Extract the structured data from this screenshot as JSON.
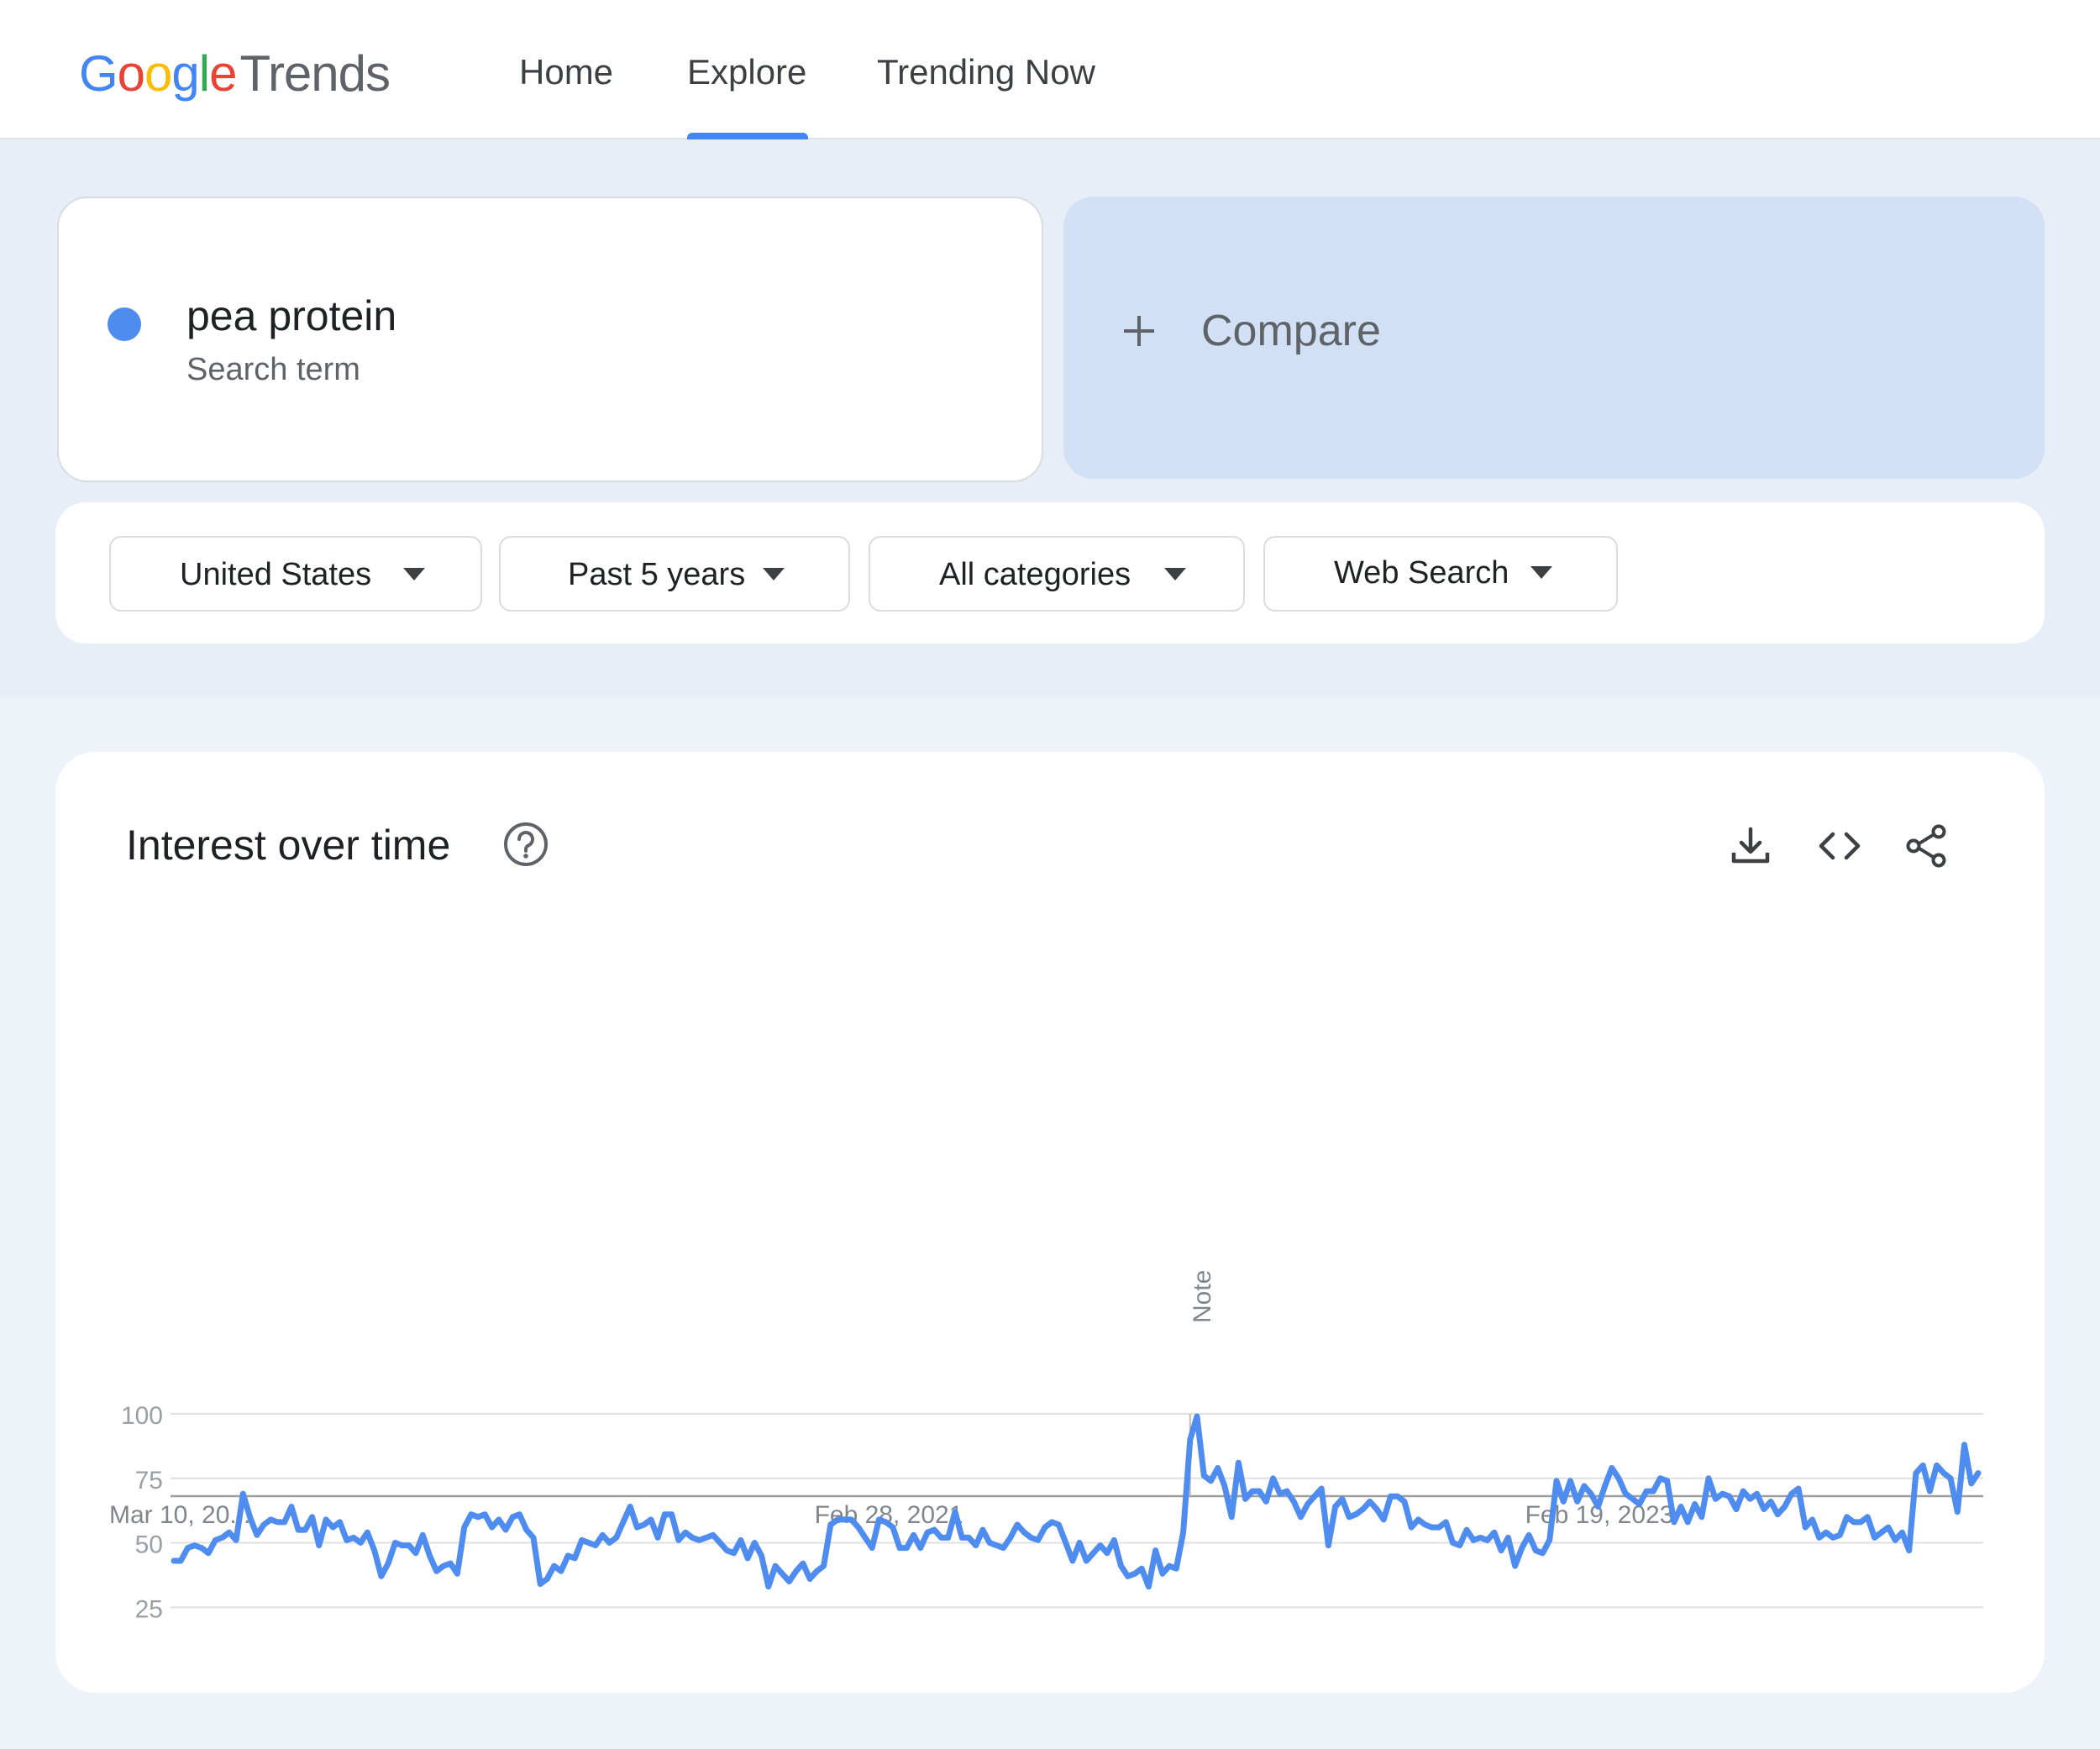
{
  "header": {
    "logo": {
      "brand_letters": [
        {
          "char": "G",
          "color": "#4285F4"
        },
        {
          "char": "o",
          "color": "#EA4335"
        },
        {
          "char": "o",
          "color": "#FBBC05"
        },
        {
          "char": "g",
          "color": "#4285F4"
        },
        {
          "char": "l",
          "color": "#34A853"
        },
        {
          "char": "e",
          "color": "#EA4335"
        }
      ],
      "product": "Trends"
    },
    "tabs": [
      {
        "label": "Home",
        "active": false
      },
      {
        "label": "Explore",
        "active": true
      },
      {
        "label": "Trending Now",
        "active": false
      }
    ],
    "active_color": "#4285f4"
  },
  "search": {
    "term": "pea protein",
    "term_type": "Search term",
    "term_color": "#4e8cf0",
    "compare_icon": "plus-icon",
    "compare_label": "Compare"
  },
  "filters": [
    {
      "label": "United States",
      "icon": "caret-down-icon"
    },
    {
      "label": "Past 5 years",
      "icon": "caret-down-icon"
    },
    {
      "label": "All categories",
      "icon": "caret-down-icon"
    },
    {
      "label": "Web Search",
      "icon": "caret-down-icon"
    }
  ],
  "panel": {
    "title": "Interest over time",
    "help_icon": "help-circle-icon",
    "tools": [
      "download-icon",
      "embed-code-icon",
      "share-icon"
    ]
  },
  "chart_data": {
    "type": "line",
    "title": "",
    "xlabel": "",
    "ylabel": "",
    "ylim": [
      0,
      100
    ],
    "yticks": [
      25,
      50,
      75,
      100
    ],
    "gridlines": true,
    "x_tick_labels": [
      "Mar 10, 20...",
      "Feb 28, 2021",
      "Feb 19, 2023"
    ],
    "annotation": {
      "label": "Note",
      "at_week_index": 147
    },
    "series_color": "#4e8cf0",
    "series": [
      {
        "values": [
          43,
          43,
          48,
          49,
          48,
          46,
          51,
          52,
          54,
          51,
          69,
          60,
          53,
          57,
          59,
          58,
          58,
          64,
          55,
          55,
          60,
          49,
          59,
          56,
          58,
          51,
          52,
          50,
          54,
          47,
          37,
          42,
          50,
          49,
          49,
          46,
          53,
          45,
          39,
          41,
          42,
          38,
          56,
          61,
          60,
          61,
          56,
          59,
          55,
          60,
          61,
          55,
          52,
          34,
          36,
          41,
          39,
          45,
          44,
          51,
          50,
          49,
          53,
          50,
          52,
          58,
          64,
          56,
          57,
          59,
          52,
          61,
          61,
          51,
          54,
          52,
          51,
          52,
          53,
          50,
          47,
          46,
          51,
          44,
          50,
          45,
          33,
          41,
          38,
          35,
          39,
          42,
          36,
          39,
          41,
          57,
          59,
          59,
          59,
          56,
          52,
          48,
          59,
          58,
          56,
          48,
          48,
          53,
          48,
          54,
          55,
          52,
          52,
          62,
          52,
          52,
          49,
          55,
          50,
          49,
          48,
          52,
          57,
          54,
          52,
          51,
          56,
          58,
          57,
          50,
          43,
          50,
          43,
          46,
          49,
          46,
          51,
          41,
          37,
          38,
          40,
          33,
          47,
          38,
          41,
          40,
          54,
          90,
          99,
          76,
          74,
          79,
          72,
          60,
          81,
          67,
          70,
          70,
          66,
          75,
          69,
          70,
          66,
          60,
          65,
          68,
          71,
          49,
          64,
          67,
          60,
          61,
          63,
          66,
          63,
          59,
          68,
          68,
          66,
          56,
          59,
          57,
          56,
          56,
          58,
          50,
          49,
          55,
          51,
          52,
          51,
          54,
          47,
          52,
          41,
          48,
          53,
          47,
          46,
          51,
          74,
          66,
          74,
          66,
          72,
          69,
          64,
          72,
          79,
          75,
          69,
          67,
          65,
          70,
          70,
          75,
          74,
          58,
          64,
          58,
          65,
          60,
          75,
          67,
          69,
          68,
          63,
          70,
          67,
          69,
          63,
          66,
          61,
          64,
          69,
          71,
          56,
          59,
          52,
          54,
          52,
          53,
          60,
          58,
          58,
          60,
          52,
          54,
          56,
          51,
          54,
          47,
          77,
          80,
          70,
          80,
          77,
          75,
          62,
          88,
          73,
          77
        ]
      }
    ]
  }
}
